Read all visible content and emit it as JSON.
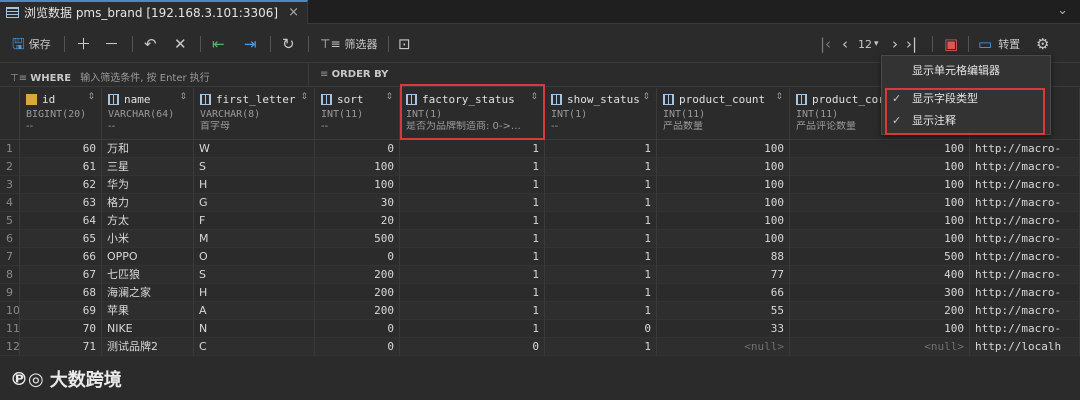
{
  "tab": {
    "title": "浏览数据 pms_brand [192.168.3.101:3306]",
    "close": "×"
  },
  "toolbar": {
    "save_label": "保存",
    "filter_label": "筛选器",
    "page_size": "12",
    "transpose_label": "转置"
  },
  "filterbar": {
    "where_keyword": "WHERE",
    "where_placeholder": "输入筛选条件, 按 Enter 执行",
    "order_keyword": "ORDER BY"
  },
  "columns": [
    {
      "name": "id",
      "type": "BIGINT(20)",
      "comment": "--"
    },
    {
      "name": "name",
      "type": "VARCHAR(64)",
      "comment": "--"
    },
    {
      "name": "first_letter",
      "type": "VARCHAR(8)",
      "comment": "首字母"
    },
    {
      "name": "sort",
      "type": "INT(11)",
      "comment": "--"
    },
    {
      "name": "factory_status",
      "type": "INT(1)",
      "comment": "是否为品牌制造商: 0->…"
    },
    {
      "name": "show_status",
      "type": "INT(1)",
      "comment": "--"
    },
    {
      "name": "product_count",
      "type": "INT(11)",
      "comment": "产品数量"
    },
    {
      "name": "product_cor",
      "type": "INT(11)",
      "comment": "产品评论数量"
    }
  ],
  "rows": [
    [
      "1",
      "60",
      "万和",
      "W",
      "0",
      "1",
      "1",
      "100",
      "100",
      "http://macro-"
    ],
    [
      "2",
      "61",
      "三星",
      "S",
      "100",
      "1",
      "1",
      "100",
      "100",
      "http://macro-"
    ],
    [
      "3",
      "62",
      "华为",
      "H",
      "100",
      "1",
      "1",
      "100",
      "100",
      "http://macro-"
    ],
    [
      "4",
      "63",
      "格力",
      "G",
      "30",
      "1",
      "1",
      "100",
      "100",
      "http://macro-"
    ],
    [
      "5",
      "64",
      "方太",
      "F",
      "20",
      "1",
      "1",
      "100",
      "100",
      "http://macro-"
    ],
    [
      "6",
      "65",
      "小米",
      "M",
      "500",
      "1",
      "1",
      "100",
      "100",
      "http://macro-"
    ],
    [
      "7",
      "66",
      "OPPO",
      "O",
      "0",
      "1",
      "1",
      "88",
      "500",
      "http://macro-"
    ],
    [
      "8",
      "67",
      "七匹狼",
      "S",
      "200",
      "1",
      "1",
      "77",
      "400",
      "http://macro-"
    ],
    [
      "9",
      "68",
      "海澜之家",
      "H",
      "200",
      "1",
      "1",
      "66",
      "300",
      "http://macro-"
    ],
    [
      "10",
      "69",
      "苹果",
      "A",
      "200",
      "1",
      "1",
      "55",
      "200",
      "http://macro-"
    ],
    [
      "11",
      "70",
      "NIKE",
      "N",
      "0",
      "1",
      "0",
      "33",
      "100",
      "http://macro-"
    ],
    [
      "12",
      "71",
      "测试品牌2",
      "C",
      "0",
      "0",
      "1",
      "<null>",
      "<null>",
      "http://localh"
    ]
  ],
  "menu": {
    "items": [
      {
        "label": "显示单元格编辑器",
        "checked": ""
      },
      {
        "label": "显示字段类型",
        "checked": "✓"
      },
      {
        "label": "显示注释",
        "checked": "✓"
      }
    ]
  },
  "watermark": {
    "logo": "℗◎",
    "text": "大数跨境"
  },
  "colors": {
    "accent": "#4a88c7",
    "highlight": "#d63a3a",
    "background": "#2b2b2b"
  }
}
